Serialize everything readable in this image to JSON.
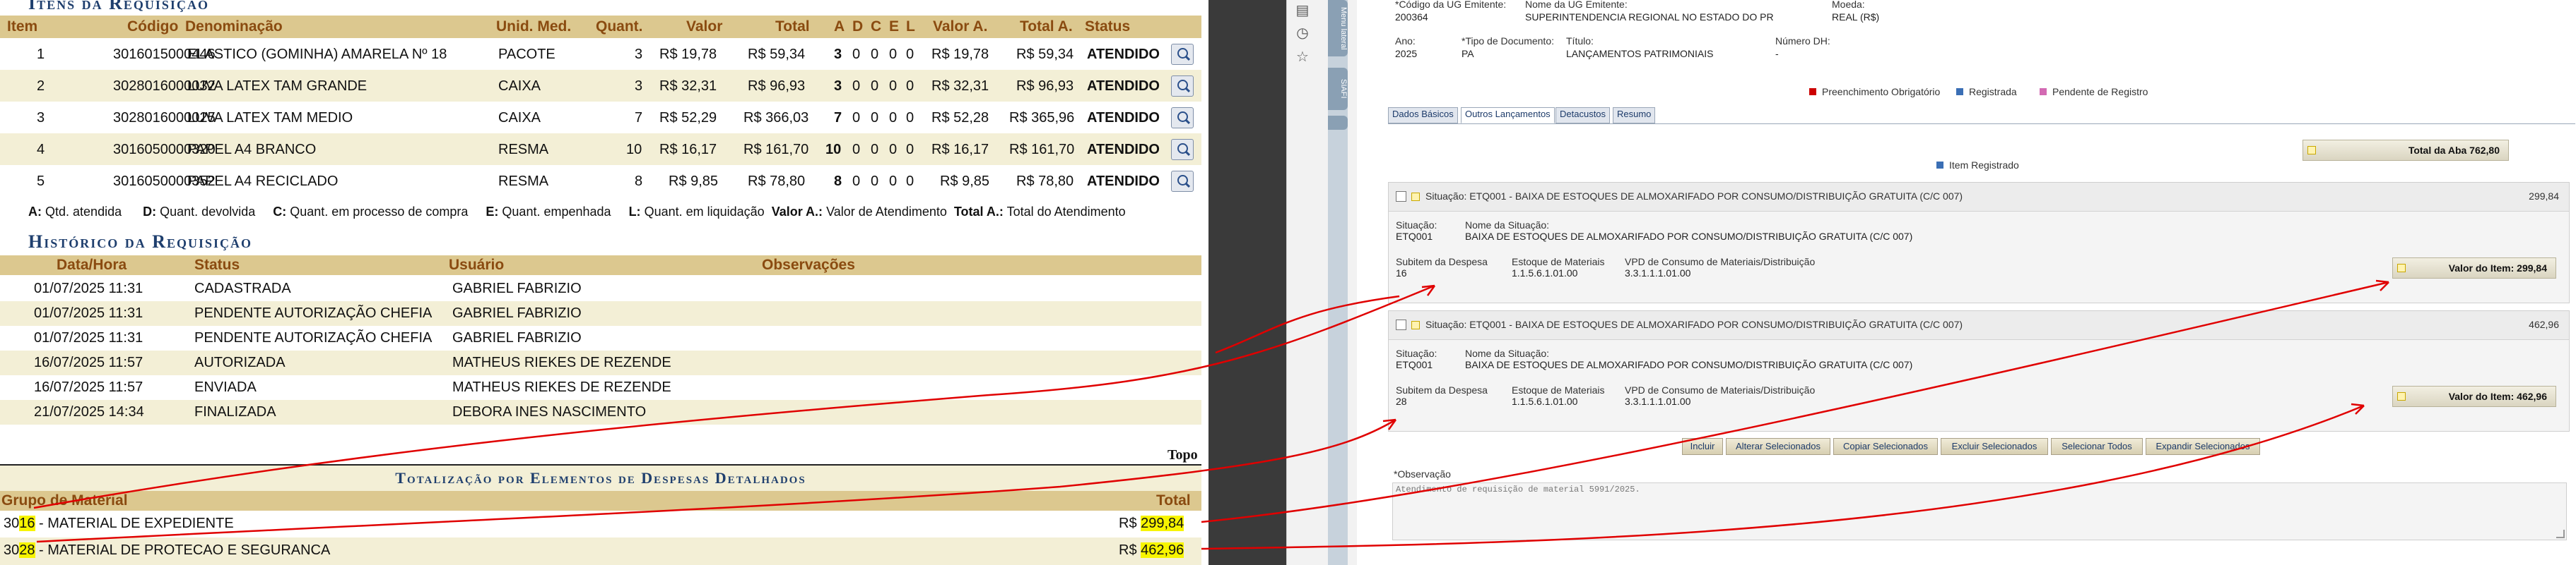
{
  "items_section": {
    "title": "Itens da Requisição",
    "headers": [
      "Item",
      "Código",
      "Denominação",
      "Unid. Med.",
      "Quant.",
      "Valor",
      "Total",
      "A",
      "D",
      "C",
      "E",
      "L",
      "Valor A.",
      "Total A.",
      "Status"
    ],
    "rows": [
      {
        "item": "1",
        "codigo": "3016015000446",
        "denominacao": "ELASTICO (GOMINHA) AMARELA Nº 18",
        "unid": "PACOTE",
        "quant": "3",
        "valor": "R$ 19,78",
        "total": "R$ 59,34",
        "a": "3",
        "d": "0",
        "c": "0",
        "e": "0",
        "l": "0",
        "valor_a": "R$ 19,78",
        "total_a": "R$ 59,34",
        "status": "ATENDIDO"
      },
      {
        "item": "2",
        "codigo": "3028016000032",
        "denominacao": "LUVA LATEX TAM GRANDE",
        "unid": "CAIXA",
        "quant": "3",
        "valor": "R$ 32,31",
        "total": "R$ 96,93",
        "a": "3",
        "d": "0",
        "c": "0",
        "e": "0",
        "l": "0",
        "valor_a": "R$ 32,31",
        "total_a": "R$ 96,93",
        "status": "ATENDIDO"
      },
      {
        "item": "3",
        "codigo": "3028016000025",
        "denominacao": "LUVA LATEX TAM MEDIO",
        "unid": "CAIXA",
        "quant": "7",
        "valor": "R$ 52,29",
        "total": "R$ 366,03",
        "a": "7",
        "d": "0",
        "c": "0",
        "e": "0",
        "l": "0",
        "valor_a": "R$ 52,28",
        "total_a": "R$ 365,96",
        "status": "ATENDIDO"
      },
      {
        "item": "4",
        "codigo": "3016050000320",
        "denominacao": "PAPEL A4 BRANCO",
        "unid": "RESMA",
        "quant": "10",
        "valor": "R$ 16,17",
        "total": "R$ 161,70",
        "a": "10",
        "d": "0",
        "c": "0",
        "e": "0",
        "l": "0",
        "valor_a": "R$ 16,17",
        "total_a": "R$ 161,70",
        "status": "ATENDIDO"
      },
      {
        "item": "5",
        "codigo": "3016050000352",
        "denominacao": "PAPEL A4 RECICLADO",
        "unid": "RESMA",
        "quant": "8",
        "valor": "R$ 9,85",
        "total": "R$ 78,80",
        "a": "8",
        "d": "0",
        "c": "0",
        "e": "0",
        "l": "0",
        "valor_a": "R$ 9,85",
        "total_a": "R$ 78,80",
        "status": "ATENDIDO"
      }
    ],
    "legend": {
      "a_key": "A:",
      "a_text": "Qtd. atendida",
      "d_key": "D:",
      "d_text": "Quant. devolvida",
      "c_key": "C:",
      "c_text": "Quant. em processo de compra",
      "e_key": "E:",
      "e_text": "Quant. empenhada",
      "l_key": "L:",
      "l_text": "Quant. em liquidação",
      "va_key": "Valor A.:",
      "va_text": "Valor de Atendimento",
      "ta_key": "Total A.:",
      "ta_text": "Total do Atendimento"
    }
  },
  "history_section": {
    "title": "Histórico da Requisição",
    "headers": [
      "Data/Hora",
      "Status",
      "Usuário",
      "Observações"
    ],
    "rows": [
      {
        "data": "01/07/2025 11:31",
        "status": "CADASTRADA",
        "usuario": "GABRIEL FABRIZIO",
        "obs": ""
      },
      {
        "data": "01/07/2025 11:31",
        "status": "PENDENTE AUTORIZAÇÃO CHEFIA",
        "usuario": "GABRIEL FABRIZIO",
        "obs": ""
      },
      {
        "data": "01/07/2025 11:31",
        "status": "PENDENTE AUTORIZAÇÃO CHEFIA",
        "usuario": "GABRIEL FABRIZIO",
        "obs": ""
      },
      {
        "data": "16/07/2025 11:57",
        "status": "AUTORIZADA",
        "usuario": "MATHEUS RIEKES DE REZENDE",
        "obs": ""
      },
      {
        "data": "16/07/2025 11:57",
        "status": "ENVIADA",
        "usuario": "MATHEUS RIEKES DE REZENDE",
        "obs": ""
      },
      {
        "data": "21/07/2025 14:34",
        "status": "FINALIZADA",
        "usuario": "DEBORA INES NASCIMENTO",
        "obs": ""
      }
    ],
    "topo_link": "Topo"
  },
  "totals_section": {
    "title": "Totalização por Elementos de Despesas Detalhados",
    "headers": [
      "Grupo de Material",
      "Total"
    ],
    "rows": [
      {
        "code_prefix": "30",
        "code_hl": "16",
        "name": " - MATERIAL DE EXPEDIENTE",
        "currency": "R$ ",
        "value": "299,84"
      },
      {
        "code_prefix": "30",
        "code_hl": "28",
        "name": " - MATERIAL DE PROTECAO E SEGURANCA",
        "currency": "R$ ",
        "value": "462,96"
      }
    ]
  },
  "form": {
    "codigo_ug_label": "*Código da UG Emitente:",
    "codigo_ug_value": "200364",
    "nome_ug_label": "Nome da UG Emitente:",
    "nome_ug_value": "SUPERINTENDENCIA REGIONAL NO ESTADO DO PR",
    "moeda_label": "Moeda:",
    "moeda_value": "REAL (R$)",
    "ano_label": "Ano:",
    "ano_value": "2025",
    "tipo_doc_label": "*Tipo de Documento:",
    "tipo_doc_value": "PA",
    "titulo_label": "Título:",
    "titulo_value": "LANÇAMENTOS PATRIMONIAIS",
    "numero_dh_label": "Número DH:",
    "numero_dh_value": "-",
    "legend_required": "Preenchimento Obrigatório",
    "legend_registered": "Registrada",
    "legend_pending": "Pendente de Registro",
    "tabs": [
      "Dados Básicos",
      "Outros Lançamentos",
      "Detacustos",
      "Resumo"
    ],
    "total_aba_label": "Total da Aba 762,80",
    "item_registered": "Item Registrado",
    "situations": [
      {
        "header": "Situação:  ETQ001 - BAIXA DE ESTOQUES DE ALMOXARIFADO POR CONSUMO/DISTRIBUIÇÃO GRATUITA (C/C 007)",
        "header_value": "299,84",
        "situacao_label": "Situação:",
        "situacao_value": "ETQ001",
        "nome_label": "Nome da Situação:",
        "nome_value": "BAIXA DE ESTOQUES DE ALMOXARIFADO POR CONSUMO/DISTRIBUIÇÃO GRATUITA (C/C 007)",
        "subitem_label": "Subitem da Despesa",
        "subitem_value": "16",
        "estoque_label": "Estoque de Materiais",
        "estoque_value": "1.1.5.6.1.01.00",
        "vpd_label": "VPD de Consumo de Materiais/Distribuição",
        "vpd_value": "3.3.1.1.1.01.00",
        "valor_item": "Valor do Item: 299,84"
      },
      {
        "header": "Situação:  ETQ001 - BAIXA DE ESTOQUES DE ALMOXARIFADO POR CONSUMO/DISTRIBUIÇÃO GRATUITA (C/C 007)",
        "header_value": "462,96",
        "situacao_label": "Situação:",
        "situacao_value": "ETQ001",
        "nome_label": "Nome da Situação:",
        "nome_value": "BAIXA DE ESTOQUES DE ALMOXARIFADO POR CONSUMO/DISTRIBUIÇÃO GRATUITA (C/C 007)",
        "subitem_label": "Subitem da Despesa",
        "subitem_value": "28",
        "estoque_label": "Estoque de Materiais",
        "estoque_value": "1.1.5.6.1.01.00",
        "vpd_label": "VPD de Consumo de Materiais/Distribuição",
        "vpd_value": "3.3.1.1.1.01.00",
        "valor_item": "Valor do Item: 462,96"
      }
    ],
    "buttons": [
      "Incluir",
      "Alterar Selecionados",
      "Copiar Selecionados",
      "Excluir Selecionados",
      "Selecionar Todos",
      "Expandir Selecionados"
    ],
    "observacao_label": "*Observação",
    "observacao_value": "Atendimento de requisição de material 5991/2025.",
    "sidebar_tab1": "Menu lateral",
    "sidebar_tab2": "SIAFI"
  },
  "colors": {
    "annotation": "#e00000",
    "highlight": "#f7f400",
    "header_band": "#dcc88f",
    "title_blue": "#1f3f6e"
  }
}
